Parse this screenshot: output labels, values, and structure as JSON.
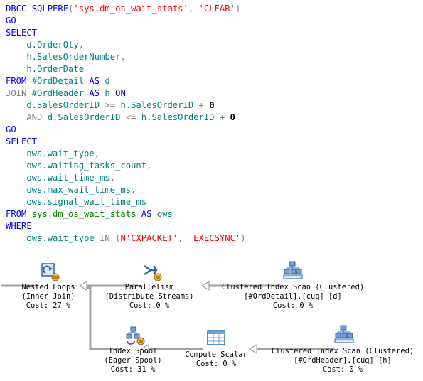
{
  "code": [
    [
      {
        "t": "DBCC ",
        "c": "kw"
      },
      {
        "t": "SQLPERF",
        "c": "kw"
      },
      {
        "t": "(",
        "c": "op"
      },
      {
        "t": "'sys.dm_os_wait_stats'",
        "c": "str"
      },
      {
        "t": ", ",
        "c": "op"
      },
      {
        "t": "'CLEAR'",
        "c": "str"
      },
      {
        "t": ")",
        "c": "op"
      }
    ],
    [
      {
        "t": "GO",
        "c": "kw"
      }
    ],
    [
      {
        "t": "SELECT",
        "c": "kw"
      }
    ],
    [
      {
        "t": "    d.OrderQty",
        "c": "id"
      },
      {
        "t": ",",
        "c": "op"
      }
    ],
    [
      {
        "t": "    h.SalesOrderNumber",
        "c": "id"
      },
      {
        "t": ",",
        "c": "op"
      }
    ],
    [
      {
        "t": "    h.OrderDate",
        "c": "id"
      }
    ],
    [
      {
        "t": "FROM ",
        "c": "kw"
      },
      {
        "t": "#OrdDetail ",
        "c": "id"
      },
      {
        "t": "AS ",
        "c": "kw"
      },
      {
        "t": "d",
        "c": "id"
      }
    ],
    [
      {
        "t": "JOIN ",
        "c": "op"
      },
      {
        "t": "#OrdHeader ",
        "c": "id"
      },
      {
        "t": "AS ",
        "c": "kw"
      },
      {
        "t": "h ",
        "c": "id"
      },
      {
        "t": "ON",
        "c": "kw"
      }
    ],
    [
      {
        "t": "    d.SalesOrderID ",
        "c": "id"
      },
      {
        "t": ">= ",
        "c": "op"
      },
      {
        "t": "h.SalesOrderID ",
        "c": "id"
      },
      {
        "t": "+ ",
        "c": "op"
      },
      {
        "t": "0",
        "c": "nm"
      }
    ],
    [
      {
        "t": "    AND ",
        "c": "op"
      },
      {
        "t": "d.SalesOrderID ",
        "c": "id"
      },
      {
        "t": "<= ",
        "c": "op"
      },
      {
        "t": "h.SalesOrderID ",
        "c": "id"
      },
      {
        "t": "+ ",
        "c": "op"
      },
      {
        "t": "0",
        "c": "nm"
      }
    ],
    [
      {
        "t": "GO",
        "c": "kw"
      }
    ],
    [
      {
        "t": "SELECT",
        "c": "kw"
      }
    ],
    [
      {
        "t": "    ows.wait_type",
        "c": "id"
      },
      {
        "t": ",",
        "c": "op"
      }
    ],
    [
      {
        "t": "    ows.waiting_tasks_count",
        "c": "id"
      },
      {
        "t": ",",
        "c": "op"
      }
    ],
    [
      {
        "t": "    ows.wait_time_ms",
        "c": "id"
      },
      {
        "t": ",",
        "c": "op"
      }
    ],
    [
      {
        "t": "    ows.max_wait_time_ms",
        "c": "id"
      },
      {
        "t": ",",
        "c": "op"
      }
    ],
    [
      {
        "t": "    ows.signal_wait_time_ms",
        "c": "id"
      }
    ],
    [
      {
        "t": "FROM ",
        "c": "kw"
      },
      {
        "t": "sys.dm_os_wait_stats ",
        "c": "ob"
      },
      {
        "t": "AS ",
        "c": "kw"
      },
      {
        "t": "ows",
        "c": "id"
      }
    ],
    [
      {
        "t": "WHERE",
        "c": "kw"
      }
    ],
    [
      {
        "t": "    ows.wait_type ",
        "c": "id"
      },
      {
        "t": "IN ",
        "c": "op"
      },
      {
        "t": "(",
        "c": "op"
      },
      {
        "t": "N'CXPACKET'",
        "c": "str"
      },
      {
        "t": ", ",
        "c": "op"
      },
      {
        "t": "'EXECSYNC'",
        "c": "str"
      },
      {
        "t": ")",
        "c": "op"
      }
    ]
  ],
  "plan": {
    "nested_loops": {
      "name": "Nested Loops",
      "detail": "(Inner Join)",
      "cost": "Cost: 27 %",
      "icon": "nested-loops-icon"
    },
    "parallelism": {
      "name": "Parallelism",
      "detail": "(Distribute Streams)",
      "cost": "Cost: 0 %",
      "icon": "parallelism-icon"
    },
    "scan_detail": {
      "name": "Clustered Index Scan (Clustered)",
      "detail": "[#OrdDetail].[cuq] [d]",
      "cost": "Cost: 0 %",
      "icon": "clustered-index-scan-icon"
    },
    "index_spool": {
      "name": "Index Spool",
      "detail": "(Eager Spool)",
      "cost": "Cost: 31 %",
      "icon": "index-spool-icon"
    },
    "compute_scalar": {
      "name": "Compute Scalar",
      "detail": "",
      "cost": "Cost: 0 %",
      "icon": "compute-scalar-icon"
    },
    "scan_header": {
      "name": "Clustered Index Scan (Clustered)",
      "detail": "[#OrdHeader].[cuq] [h]",
      "cost": "Cost: 0 %",
      "icon": "clustered-index-scan-icon"
    }
  },
  "colors": {
    "keyword": "#0000ff",
    "function": "#ff00ff",
    "object": "#008000",
    "string": "#ff0000",
    "operator": "#808080",
    "identifier": "#008080"
  }
}
